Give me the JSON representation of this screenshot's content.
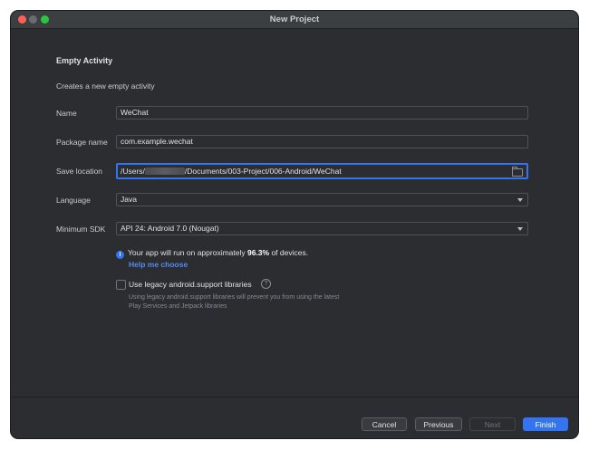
{
  "window": {
    "title": "New Project"
  },
  "template": {
    "heading": "Empty Activity",
    "description": "Creates a new empty activity"
  },
  "form": {
    "name": {
      "label": "Name",
      "value": "WeChat"
    },
    "package": {
      "label": "Package name",
      "value": "com.example.wechat"
    },
    "save_location": {
      "label": "Save location",
      "value_prefix": "/Users/",
      "value_suffix": "/Documents/003-Project/006-Android/WeChat"
    },
    "language": {
      "label": "Language",
      "value": "Java"
    },
    "min_sdk": {
      "label": "Minimum SDK",
      "value": "API 24: Android 7.0 (Nougat)"
    }
  },
  "info": {
    "prefix": "Your app will run on approximately ",
    "percent": "96.3%",
    "suffix": " of devices.",
    "link": "Help me choose"
  },
  "legacy": {
    "label": "Use legacy android.support libraries",
    "checked": false,
    "description": "Using legacy android.support libraries will prevent you from using the latest Play Services and Jetpack libraries"
  },
  "buttons": {
    "cancel": "Cancel",
    "previous": "Previous",
    "next": "Next",
    "finish": "Finish"
  },
  "colors": {
    "background": "#2b2d30",
    "accent": "#3574f0",
    "link": "#548af7"
  }
}
